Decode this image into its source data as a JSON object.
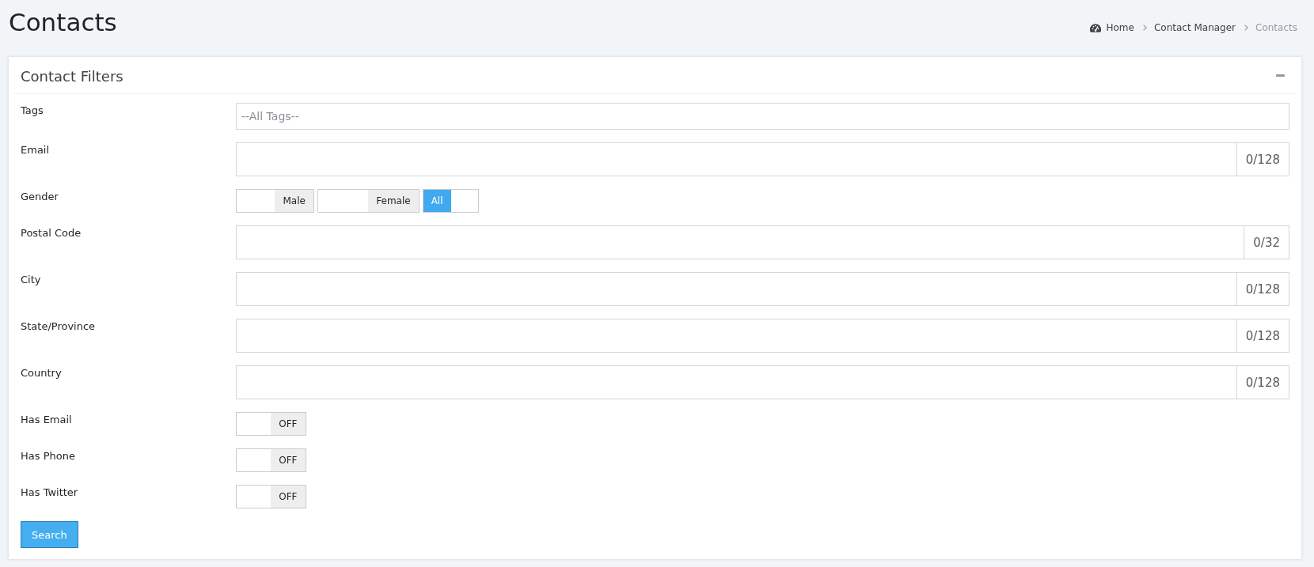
{
  "page": {
    "title": "Contacts"
  },
  "breadcrumb": [
    {
      "label": "Home",
      "kind": "home"
    },
    {
      "label": "Contact Manager",
      "kind": "link"
    },
    {
      "label": "Contacts",
      "kind": "current"
    }
  ],
  "panel": {
    "title": "Contact Filters"
  },
  "filters": [
    {
      "kind": "select",
      "label": "Tags",
      "placeholder": "--All Tags--"
    },
    {
      "kind": "text",
      "label": "Email",
      "counter": "0/128"
    },
    {
      "kind": "choice",
      "label": "Gender",
      "options": [
        {
          "label": "Male",
          "selected": false
        },
        {
          "label": "Female",
          "selected": false
        },
        {
          "label": "All",
          "selected": true
        }
      ]
    },
    {
      "kind": "text",
      "label": "Postal Code",
      "counter": "0/32"
    },
    {
      "kind": "text",
      "label": "City",
      "counter": "0/128"
    },
    {
      "kind": "text",
      "label": "State/Province",
      "counter": "0/128"
    },
    {
      "kind": "text",
      "label": "Country",
      "counter": "0/128"
    },
    {
      "kind": "switch",
      "label": "Has Email",
      "on": false,
      "state_text": "OFF"
    },
    {
      "kind": "switch",
      "label": "Has Phone",
      "on": false,
      "state_text": "OFF"
    },
    {
      "kind": "switch",
      "label": "Has Twitter",
      "on": false,
      "state_text": "OFF"
    }
  ],
  "search_button": {
    "label": "Search"
  }
}
